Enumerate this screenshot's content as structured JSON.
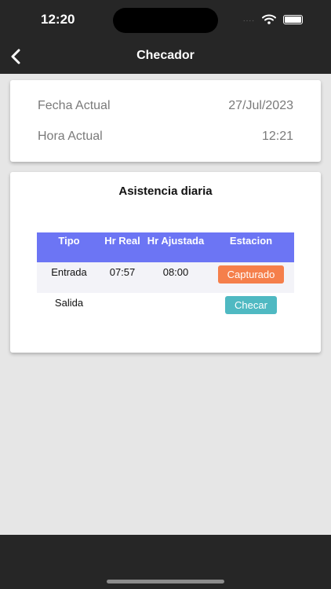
{
  "status_bar": {
    "time": "12:20",
    "dots": "...."
  },
  "nav": {
    "title": "Checador",
    "back_icon": "chevron-left"
  },
  "info": {
    "fecha_label": "Fecha Actual",
    "fecha_value": "27/Jul/2023",
    "hora_label": "Hora Actual",
    "hora_value": "12:21"
  },
  "attendance": {
    "title": "Asistencia diaria",
    "headers": [
      "Tipo",
      "Hr Real",
      "Hr Ajustada",
      "Estacion"
    ],
    "rows": [
      {
        "tipo": "Entrada",
        "hr_real": "07:57",
        "hr_ajustada": "08:00",
        "action": "Capturado"
      },
      {
        "tipo": "Salida",
        "hr_real": "",
        "hr_ajustada": "",
        "action": "Checar"
      }
    ]
  },
  "colors": {
    "header_bg": "#262626",
    "table_header": "#6c75f4",
    "capturado_button": "#f57f4b",
    "checar_button": "#4fb9c2"
  }
}
